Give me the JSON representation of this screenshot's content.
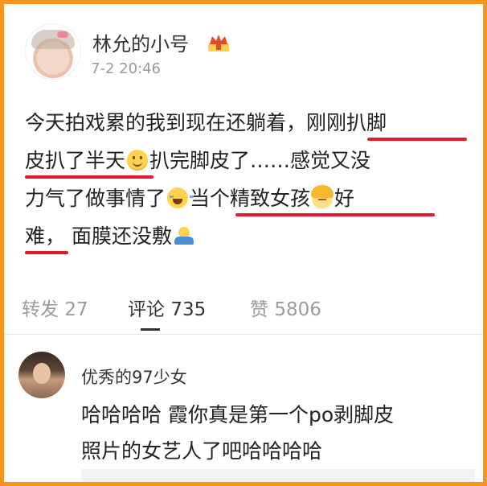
{
  "post": {
    "username": "林允的小号",
    "badge_icon": "vip-crown-icon",
    "timestamp": "7-2 20:46",
    "lines": [
      [
        "今天拍戏累的我到现在还躺着，",
        "刚刚扒脚"
      ],
      [
        "皮扒了半天",
        "扒完脚皮了……感觉又没"
      ],
      [
        "力气了做事情了",
        "当个精致女孩",
        "好"
      ],
      [
        "难，",
        "面膜还没敷"
      ]
    ],
    "emojis": [
      "smile-emoji-icon",
      "laughing-crying-emoji-icon",
      "girl-emoji-icon",
      "shrug-emoji-icon"
    ],
    "highlight_color": "#e8162c"
  },
  "actions": {
    "repost_label": "转发",
    "repost_count": "27",
    "comment_label": "评论",
    "comment_count": "735",
    "like_label": "赞",
    "like_count": "5806"
  },
  "comment": {
    "username": "优秀的97少女",
    "line1": "哈哈哈哈 霞你真是第一个po剥脚皮",
    "line2": "照片的女艺人了吧哈哈哈哈"
  },
  "colors": {
    "frame": "#f7941d",
    "muted": "#9b9b9b"
  }
}
